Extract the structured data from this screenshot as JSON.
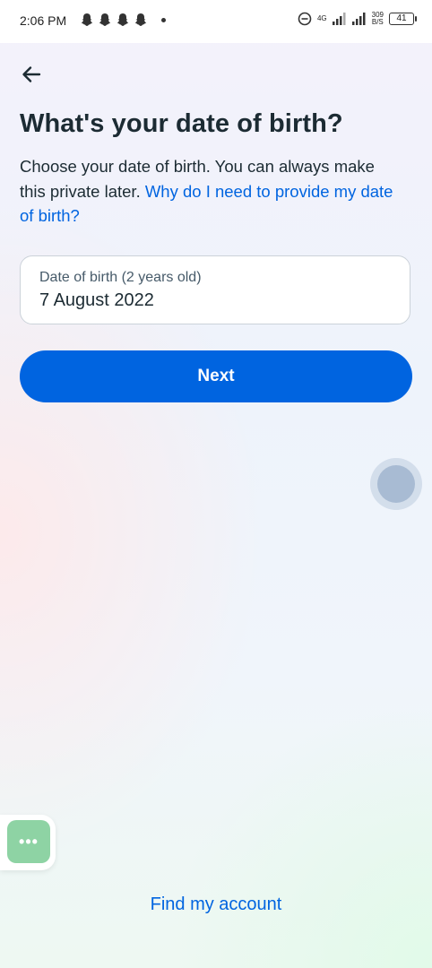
{
  "status_bar": {
    "time": "2:06 PM",
    "notification_icons": [
      "snapchat-icon",
      "snapchat-icon",
      "snapchat-icon",
      "snapchat-icon"
    ],
    "network_type": "4G",
    "network_speed_value": "309",
    "network_speed_unit": "B/S",
    "battery_level": "41"
  },
  "header": {
    "back_icon": "arrow-left-icon"
  },
  "main": {
    "title": "What's your date of birth?",
    "description": "Choose your date of birth. You can always make this private later.",
    "help_link": "Why do I need to provide my date of birth?",
    "dob_field": {
      "label": "Date of birth (2 years old)",
      "value": "7 August 2022"
    },
    "next_label": "Next"
  },
  "footer": {
    "find_account_label": "Find my account"
  },
  "floating_menu": {
    "label": "•••"
  },
  "colors": {
    "accent": "#0064e0",
    "text": "#1c2b33",
    "floating_menu_bg": "#8ed3a4"
  }
}
